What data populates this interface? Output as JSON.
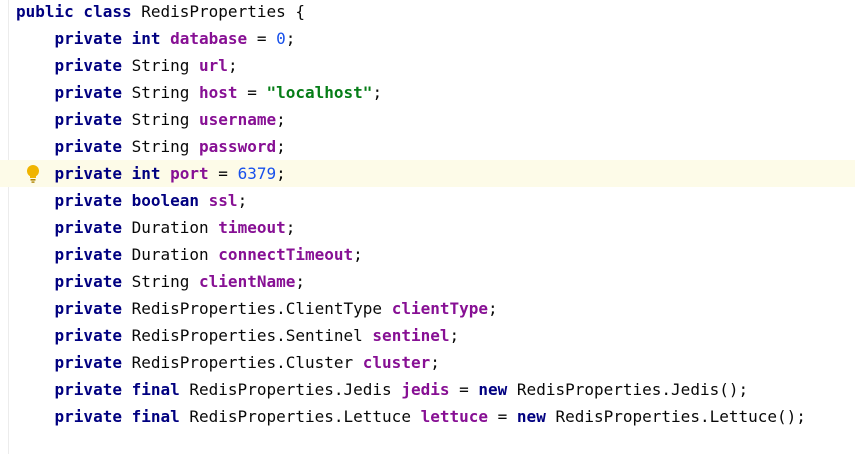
{
  "editor": {
    "current_line_index": 6,
    "lines": [
      {
        "indent": "",
        "tokens": [
          {
            "t": "public class ",
            "c": "kw"
          },
          {
            "t": "RedisProperties {",
            "c": "plain"
          }
        ]
      },
      {
        "indent": "    ",
        "tokens": [
          {
            "t": "private int ",
            "c": "kw"
          },
          {
            "t": "database",
            "c": "field"
          },
          {
            "t": " = ",
            "c": "plain"
          },
          {
            "t": "0",
            "c": "num"
          },
          {
            "t": ";",
            "c": "plain"
          }
        ]
      },
      {
        "indent": "    ",
        "tokens": [
          {
            "t": "private ",
            "c": "kw"
          },
          {
            "t": "String ",
            "c": "plain"
          },
          {
            "t": "url",
            "c": "field"
          },
          {
            "t": ";",
            "c": "plain"
          }
        ]
      },
      {
        "indent": "    ",
        "tokens": [
          {
            "t": "private ",
            "c": "kw"
          },
          {
            "t": "String ",
            "c": "plain"
          },
          {
            "t": "host",
            "c": "field"
          },
          {
            "t": " = ",
            "c": "plain"
          },
          {
            "t": "\"localhost\"",
            "c": "str"
          },
          {
            "t": ";",
            "c": "plain"
          }
        ]
      },
      {
        "indent": "    ",
        "tokens": [
          {
            "t": "private ",
            "c": "kw"
          },
          {
            "t": "String ",
            "c": "plain"
          },
          {
            "t": "username",
            "c": "field"
          },
          {
            "t": ";",
            "c": "plain"
          }
        ]
      },
      {
        "indent": "    ",
        "tokens": [
          {
            "t": "private ",
            "c": "kw"
          },
          {
            "t": "String ",
            "c": "plain"
          },
          {
            "t": "password",
            "c": "field"
          },
          {
            "t": ";",
            "c": "plain"
          }
        ]
      },
      {
        "indent": "    ",
        "tokens": [
          {
            "t": "private int ",
            "c": "kw"
          },
          {
            "t": "port",
            "c": "field"
          },
          {
            "t": " = ",
            "c": "plain"
          },
          {
            "t": "6379",
            "c": "num"
          },
          {
            "t": ";",
            "c": "plain"
          }
        ]
      },
      {
        "indent": "    ",
        "tokens": [
          {
            "t": "private boolean ",
            "c": "kw"
          },
          {
            "t": "ssl",
            "c": "field"
          },
          {
            "t": ";",
            "c": "plain"
          }
        ]
      },
      {
        "indent": "    ",
        "tokens": [
          {
            "t": "private ",
            "c": "kw"
          },
          {
            "t": "Duration ",
            "c": "plain"
          },
          {
            "t": "timeout",
            "c": "field"
          },
          {
            "t": ";",
            "c": "plain"
          }
        ]
      },
      {
        "indent": "    ",
        "tokens": [
          {
            "t": "private ",
            "c": "kw"
          },
          {
            "t": "Duration ",
            "c": "plain"
          },
          {
            "t": "connectTimeout",
            "c": "field"
          },
          {
            "t": ";",
            "c": "plain"
          }
        ]
      },
      {
        "indent": "    ",
        "tokens": [
          {
            "t": "private ",
            "c": "kw"
          },
          {
            "t": "String ",
            "c": "plain"
          },
          {
            "t": "clientName",
            "c": "field"
          },
          {
            "t": ";",
            "c": "plain"
          }
        ]
      },
      {
        "indent": "    ",
        "tokens": [
          {
            "t": "private ",
            "c": "kw"
          },
          {
            "t": "RedisProperties.ClientType ",
            "c": "plain"
          },
          {
            "t": "clientType",
            "c": "field"
          },
          {
            "t": ";",
            "c": "plain"
          }
        ]
      },
      {
        "indent": "    ",
        "tokens": [
          {
            "t": "private ",
            "c": "kw"
          },
          {
            "t": "RedisProperties.Sentinel ",
            "c": "plain"
          },
          {
            "t": "sentinel",
            "c": "field"
          },
          {
            "t": ";",
            "c": "plain"
          }
        ]
      },
      {
        "indent": "    ",
        "tokens": [
          {
            "t": "private ",
            "c": "kw"
          },
          {
            "t": "RedisProperties.Cluster ",
            "c": "plain"
          },
          {
            "t": "cluster",
            "c": "field"
          },
          {
            "t": ";",
            "c": "plain"
          }
        ]
      },
      {
        "indent": "    ",
        "tokens": [
          {
            "t": "private final ",
            "c": "kw"
          },
          {
            "t": "RedisProperties.Jedis ",
            "c": "plain"
          },
          {
            "t": "jedis",
            "c": "field"
          },
          {
            "t": " = ",
            "c": "plain"
          },
          {
            "t": "new ",
            "c": "kw"
          },
          {
            "t": "RedisProperties.Jedis();",
            "c": "plain"
          }
        ]
      },
      {
        "indent": "    ",
        "tokens": [
          {
            "t": "private final ",
            "c": "kw"
          },
          {
            "t": "RedisProperties.Lettuce ",
            "c": "plain"
          },
          {
            "t": "lettuce",
            "c": "field"
          },
          {
            "t": " = ",
            "c": "plain"
          },
          {
            "t": "new ",
            "c": "kw"
          },
          {
            "t": "RedisProperties.Lettuce();",
            "c": "plain"
          }
        ]
      }
    ]
  },
  "colors": {
    "keyword": "#000080",
    "field": "#871094",
    "number": "#1750eb",
    "string": "#067d17",
    "current_line_bg": "#fdfbe8",
    "bulb": "#f0b400"
  },
  "icons": {
    "intention_bulb": "lightbulb-icon"
  }
}
